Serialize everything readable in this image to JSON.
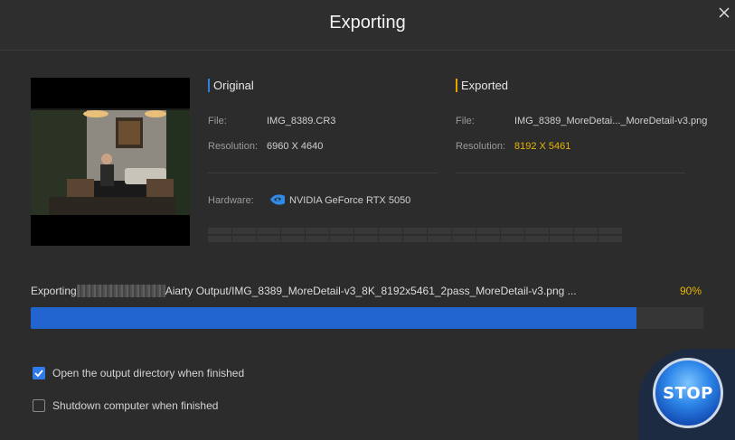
{
  "window": {
    "title": "Exporting"
  },
  "original": {
    "header": "Original",
    "file_label": "File:",
    "file_value": "IMG_8389.CR3",
    "resolution_label": "Resolution:",
    "resolution_value": "6960 X 4640"
  },
  "exported": {
    "header": "Exported",
    "file_label": "File:",
    "file_value": "IMG_8389_MoreDetai..._MoreDetail-v3.png",
    "resolution_label": "Resolution:",
    "resolution_value": "8192 X 5461"
  },
  "hardware": {
    "label": "Hardware:",
    "icon": "nvidia-icon",
    "value": "NVIDIA GeForce RTX 5050"
  },
  "progress": {
    "prefix": "Exporting",
    "path": "Aiarty Output/IMG_8389_MoreDetail-v3_8K_8192x5461_2pass_MoreDetail-v3.png ...",
    "percent_text": "90%",
    "fraction": 0.9
  },
  "options": {
    "open_output": "Open the output directory when finished",
    "open_output_checked": true,
    "shutdown": "Shutdown computer when finished",
    "shutdown_checked": false
  },
  "stop_label": "STOP",
  "colors": {
    "accent_blue": "#2264d0",
    "accent_yellow": "#e8b400"
  }
}
